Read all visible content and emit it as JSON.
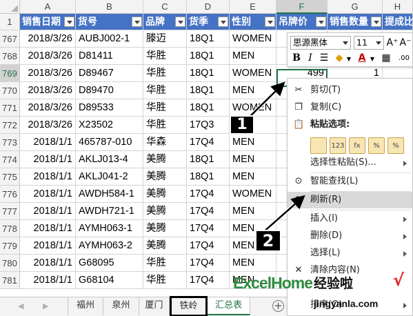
{
  "columns": [
    "A",
    "B",
    "C",
    "D",
    "E",
    "F",
    "G",
    "H"
  ],
  "selected_column": "F",
  "header_row": {
    "row_number": "1",
    "fields": [
      "销售日期",
      "货号",
      "品牌",
      "货季",
      "性别",
      "吊牌价",
      "销售数量",
      "提成比"
    ]
  },
  "rows": [
    {
      "row": "767",
      "date": "2018/3/26",
      "sku": "AUBJ002-1",
      "brand": "滕迈",
      "season": "18Q1",
      "gender": "WOMEN"
    },
    {
      "row": "768",
      "date": "2018/3/26",
      "sku": "D81411",
      "brand": "华胜",
      "season": "18Q1",
      "gender": "MEN"
    },
    {
      "row": "769",
      "date": "2018/3/26",
      "sku": "D89467",
      "brand": "华胜",
      "season": "18Q1",
      "gender": "WOMEN",
      "price": "499",
      "qty": "1"
    },
    {
      "row": "770",
      "date": "2018/3/26",
      "sku": "D89470",
      "brand": "华胜",
      "season": "18Q1",
      "gender": "MEN"
    },
    {
      "row": "771",
      "date": "2018/3/26",
      "sku": "D89533",
      "brand": "华胜",
      "season": "18Q1",
      "gender": "WOMEN"
    },
    {
      "row": "772",
      "date": "2018/3/26",
      "sku": "X23502",
      "brand": "华胜",
      "season": "17Q3",
      "gender": ""
    },
    {
      "row": "773",
      "date": "2018/1/1",
      "sku": "465787-010",
      "brand": "华森",
      "season": "17Q4",
      "gender": "MEN"
    },
    {
      "row": "774",
      "date": "2018/1/1",
      "sku": "AKLJ013-4",
      "brand": "美腾",
      "season": "18Q1",
      "gender": "MEN"
    },
    {
      "row": "775",
      "date": "2018/1/1",
      "sku": "AKLJ041-2",
      "brand": "美腾",
      "season": "18Q1",
      "gender": "MEN"
    },
    {
      "row": "776",
      "date": "2018/1/1",
      "sku": "AWDH584-1",
      "brand": "美腾",
      "season": "17Q4",
      "gender": "WOMEN"
    },
    {
      "row": "777",
      "date": "2018/1/1",
      "sku": "AWDH721-1",
      "brand": "美腾",
      "season": "17Q4",
      "gender": "MEN"
    },
    {
      "row": "778",
      "date": "2018/1/1",
      "sku": "AYMH063-1",
      "brand": "美腾",
      "season": "17Q4",
      "gender": "MEN"
    },
    {
      "row": "779",
      "date": "2018/1/1",
      "sku": "AYMH063-2",
      "brand": "美腾",
      "season": "17Q4",
      "gender": "MEN"
    },
    {
      "row": "780",
      "date": "2018/1/1",
      "sku": "G68095",
      "brand": "华胜",
      "season": "17Q4",
      "gender": "MEN"
    },
    {
      "row": "781",
      "date": "2018/1/1",
      "sku": "G68104",
      "brand": "华胜",
      "season": "17Q4",
      "gender": "MEN"
    }
  ],
  "sheet_tabs": [
    "福州",
    "泉州",
    "厦门",
    "铁岭",
    "汇总表"
  ],
  "active_tab": "汇总表",
  "mini_toolbar": {
    "font_name": "思源黑体",
    "font_size": "11",
    "grow_font_icon": "A⁺",
    "shrink_font_icon": "A⁻",
    "bold_label": "B",
    "italic_label": "I",
    "font_color_label": "A",
    "number_format_label": ".00",
    "decimal_label": ".0",
    "accent": "#217346"
  },
  "context_menu": {
    "cut": "剪切(T)",
    "copy": "复制(C)",
    "paste_options": "粘贴选项:",
    "paste_special": "选择性粘贴(S)...",
    "smart_lookup": "智能查找(L)",
    "refresh": "刷新(R)",
    "insert": "插入(I)",
    "delete": "删除(D)",
    "select": "选择(L)",
    "clear_contents": "清除内容(N)",
    "sort": "排序(O)",
    "paste_icons": [
      "",
      "123",
      "fx",
      "%",
      "%"
    ]
  },
  "annotations": {
    "step1": "1",
    "step2": "2"
  },
  "watermark": {
    "brand": "ExcelHome",
    "site": "经验啦",
    "check": "√",
    "url": "jingyanla.com"
  },
  "colors": {
    "header_fill": "#4472c4",
    "selection": "#217346",
    "menu_highlight": "#d9d9d9"
  }
}
